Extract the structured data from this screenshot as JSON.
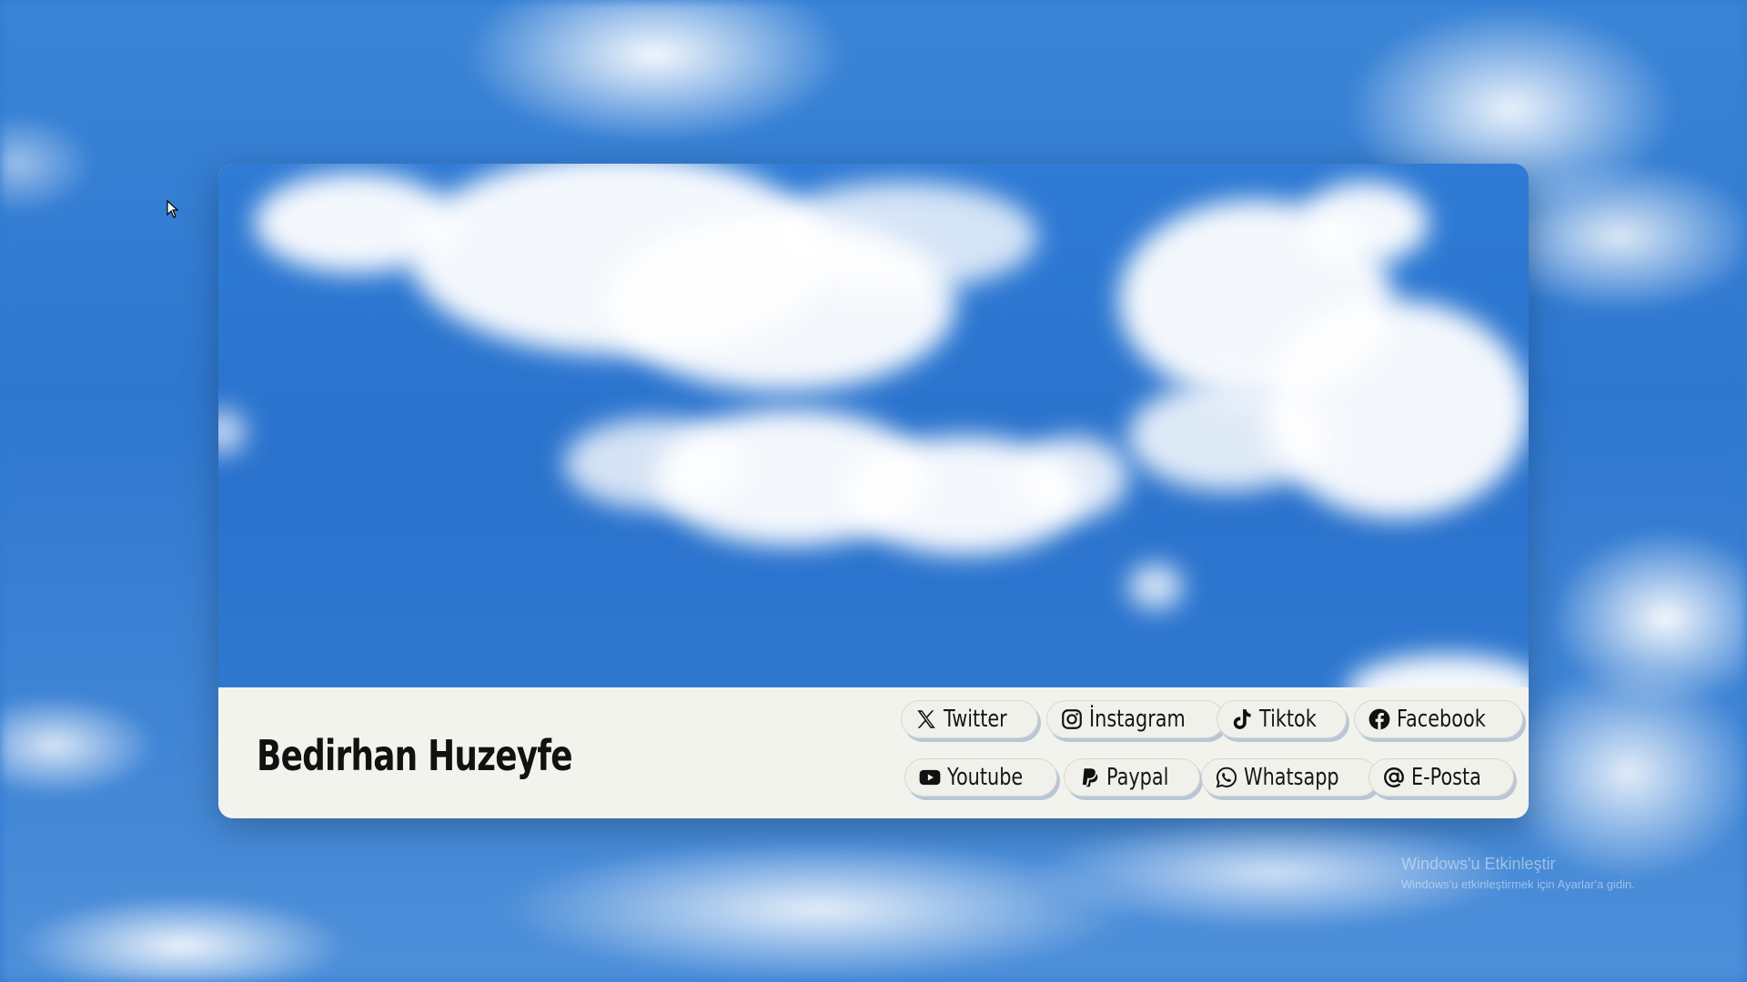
{
  "profile": {
    "name": "Bedirhan Huzeyfe"
  },
  "links": {
    "twitter": {
      "label": "Twitter",
      "icon": "x-icon"
    },
    "instagram": {
      "label": "İnstagram",
      "icon": "instagram-icon"
    },
    "tiktok": {
      "label": "Tiktok",
      "icon": "tiktok-icon"
    },
    "facebook": {
      "label": "Facebook",
      "icon": "facebook-icon"
    },
    "youtube": {
      "label": "Youtube",
      "icon": "youtube-icon"
    },
    "paypal": {
      "label": "Paypal",
      "icon": "paypal-icon"
    },
    "whatsapp": {
      "label": "Whatsapp",
      "icon": "whatsapp-icon"
    },
    "email": {
      "label": "E-Posta",
      "icon": "at-sign-icon"
    }
  },
  "watermark": {
    "title": "Windows'u Etkinleştir",
    "subtitle": "Windows'u etkinleştirmek için Ayarlar'a gidin."
  },
  "colors": {
    "sky": "#2f7bd5",
    "card_footer": "#f3f3ee",
    "button_shadow": "#b9c6d6",
    "text": "#111111"
  }
}
